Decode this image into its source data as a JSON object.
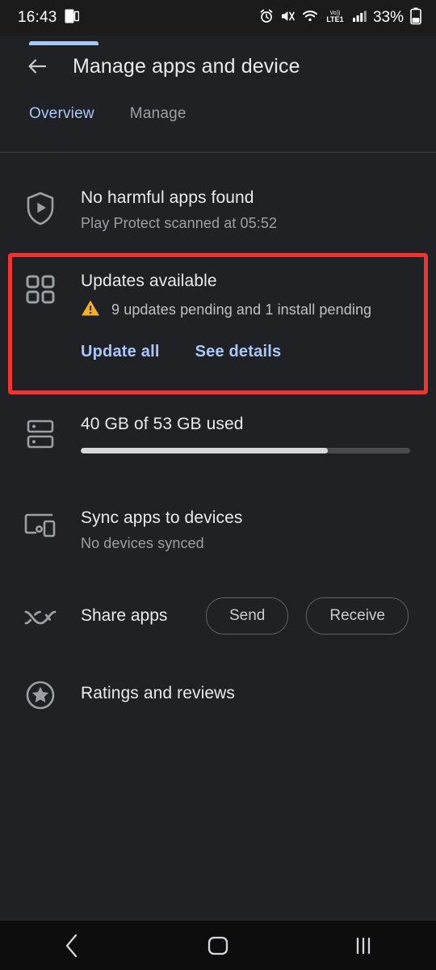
{
  "status_bar": {
    "time": "16:43",
    "battery_percent": "33%",
    "network_label": "LTE1",
    "volte_label": "Vo))",
    "icons": [
      "multi-window-icon",
      "alarm-icon",
      "mute-icon",
      "wifi-icon",
      "volte-icon",
      "signal-icon",
      "battery-icon"
    ]
  },
  "app_bar": {
    "back_icon": "back-arrow-icon",
    "title": "Manage apps and device"
  },
  "tabs": [
    {
      "label": "Overview",
      "active": true
    },
    {
      "label": "Manage",
      "active": false
    }
  ],
  "rows": {
    "play_protect": {
      "icon": "shield-play-icon",
      "title": "No harmful apps found",
      "subtitle": "Play Protect scanned at 05:52"
    },
    "updates": {
      "icon": "apps-grid-icon",
      "title": "Updates available",
      "warning_icon": "warning-triangle-icon",
      "subtitle": "9 updates pending and 1 install pending",
      "update_all_label": "Update all",
      "see_details_label": "See details",
      "highlight_color": "#f3332f"
    },
    "storage": {
      "icon": "storage-icon",
      "title": "40 GB of 53 GB used",
      "used_gb": 40,
      "total_gb": 53,
      "fill_percent": 75
    },
    "sync": {
      "icon": "devices-icon",
      "title": "Sync apps to devices",
      "subtitle": "No devices synced"
    },
    "share": {
      "icon": "share-apps-icon",
      "title": "Share apps",
      "send_label": "Send",
      "receive_label": "Receive"
    },
    "ratings": {
      "icon": "star-circle-icon",
      "title": "Ratings and reviews"
    }
  },
  "nav_bar": {
    "back_icon": "nav-back-icon",
    "home_icon": "nav-home-icon",
    "recents_icon": "nav-recents-icon"
  },
  "colors": {
    "accent_blue": "#a8c7fa",
    "warning_amber": "#f5b125",
    "highlight_red": "#f3332f",
    "background": "#202124"
  }
}
